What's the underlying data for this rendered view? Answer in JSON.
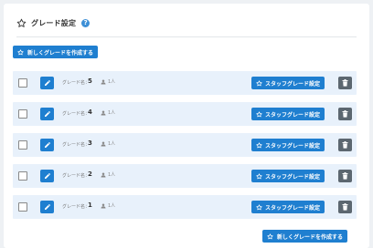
{
  "header": {
    "title": "グレード設定",
    "help": "?"
  },
  "add_button_top": "新しくグレードを作成する",
  "add_button_bottom": "新しくグレードを作成する",
  "colors": {
    "primary": "#1f7fd0",
    "row_bg": "#e8f1fb",
    "delete": "#5c6770"
  },
  "grades": [
    {
      "label": "グレード名：",
      "value": "5",
      "count": "1人",
      "staff_button": "スタッフグレード設定"
    },
    {
      "label": "グレード名：",
      "value": "4",
      "count": "1人",
      "staff_button": "スタッフグレード設定"
    },
    {
      "label": "グレード名：",
      "value": "3",
      "count": "1人",
      "staff_button": "スタッフグレード設定"
    },
    {
      "label": "グレード名：",
      "value": "2",
      "count": "1人",
      "staff_button": "スタッフグレード設定"
    },
    {
      "label": "グレード名：",
      "value": "1",
      "count": "1人",
      "staff_button": "スタッフグレード設定"
    }
  ]
}
